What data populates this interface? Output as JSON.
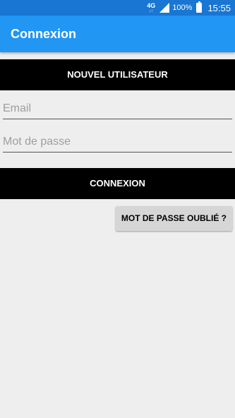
{
  "status_bar": {
    "network_type": "4G",
    "network_arrows": "↓↑",
    "battery_percent": "100%",
    "time": "15:55",
    "signal_icon": "signal-icon",
    "battery_icon": "battery-icon"
  },
  "app_bar": {
    "title": "Connexion",
    "color": "#2196f3"
  },
  "form": {
    "new_user_label": "NOUVEL UTILISATEUR",
    "email_value": "",
    "email_placeholder": "Email",
    "password_value": "",
    "password_placeholder": "Mot de passe",
    "login_label": "CONNEXION",
    "forgot_password_label": "MOT DE PASSE OUBLIÉ ?"
  },
  "colors": {
    "status_bar": "#1976d2",
    "app_bar": "#2196f3",
    "primary_button": "#000000",
    "background": "#eeeeee"
  }
}
